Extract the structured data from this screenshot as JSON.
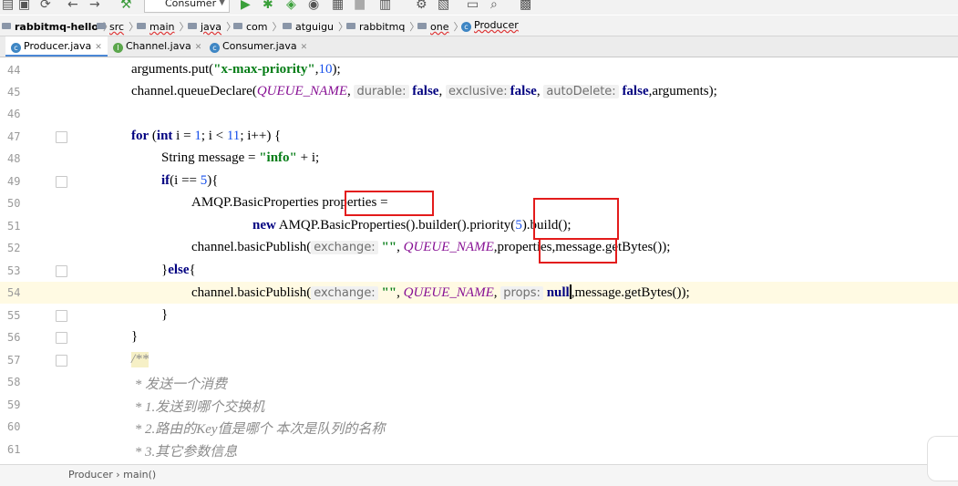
{
  "toolbar": {
    "run_config": "Consumer",
    "icons": [
      "save-icon",
      "sync-icon",
      "back-icon",
      "forward-icon",
      "build-icon",
      "run-icon",
      "debug-icon",
      "coverage-icon",
      "profile-icon",
      "stop-icon",
      "project-structure-icon",
      "sdk-icon",
      "layout-icon",
      "search-icon",
      "services-icon"
    ]
  },
  "breadcrumb": {
    "project": "rabbitmq-hello",
    "items": [
      "src",
      "main",
      "java",
      "com",
      "atguigu",
      "rabbitmq",
      "one"
    ],
    "file": "Producer"
  },
  "tabs": [
    {
      "label": "Producer.java",
      "active": true
    },
    {
      "label": "Channel.java",
      "active": false
    },
    {
      "label": "Consumer.java",
      "active": false
    }
  ],
  "editor": {
    "line_numbers": [
      "44",
      "45",
      "46",
      "47",
      "48",
      "49",
      "50",
      "51",
      "52",
      "53",
      "54",
      "55",
      "56",
      "57",
      "58",
      "59",
      "60",
      "61"
    ],
    "l44": {
      "a": "arguments.put(",
      "s": "\"x-max-priority\"",
      "b": ",",
      "n": "10",
      "c": ");"
    },
    "l45": {
      "a": "channel.queueDeclare(",
      "const": "QUEUE_NAME",
      "comma": ",",
      "h1": "durable:",
      "v1": "false",
      "h2": "exclusive:",
      "v2": "false",
      "h3": "autoDelete:",
      "v3": "false",
      "tail": ",arguments);"
    },
    "l47": {
      "kw1": "for",
      "a": " (",
      "kw2": "int",
      "b": " i = ",
      "n1": "1",
      "c": "; i < ",
      "n2": "11",
      "d": "; i++) {"
    },
    "l48": {
      "a": "String message = ",
      "s": "\"info\"",
      "b": " + i;"
    },
    "l49": {
      "kw": "if",
      "a": "(i == ",
      "n": "5",
      "b": "){"
    },
    "l50": {
      "a": "AMQP.BasicProperties ",
      "b": "properties",
      "c": " ="
    },
    "l51": {
      "kw": "new",
      "a": " AMQP.BasicProperties().builder().",
      "b": "priority(",
      "n": "5",
      "c": ").build();"
    },
    "l52": {
      "a": "channel.basicPublish(",
      "h": "exchange:",
      "s": "\"\"",
      "comma": ",",
      "const": "QUEUE_NAME",
      "comma2": ",",
      "b": "properties",
      "c": ",message.getBytes());"
    },
    "l53": {
      "a": "}",
      "kw": "else",
      "b": "{"
    },
    "l54": {
      "a": "channel.basicPublish(",
      "h": "exchange:",
      "s": "\"\"",
      "comma": ",",
      "const": "QUEUE_NAME",
      "comma2": ",",
      "h2": "props:",
      "kw": "null",
      "c": ",message.getBytes());"
    },
    "l55": "}",
    "l56": "}",
    "l57": "/**",
    "l58": " * 发送一个消费",
    "l59": " * 1.发送到哪个交换机",
    "l60": " * 2.路由的Key值是哪个 本次是队列的名称",
    "l61": " * 3.其它参数信息"
  },
  "status": {
    "breadcrumb": "Producer  ›  main()"
  },
  "colors": {
    "highlight_box": "#e31b1b",
    "keyword": "#000080",
    "string": "#067d17",
    "constant": "#871094",
    "current_line": "#fffae3"
  }
}
